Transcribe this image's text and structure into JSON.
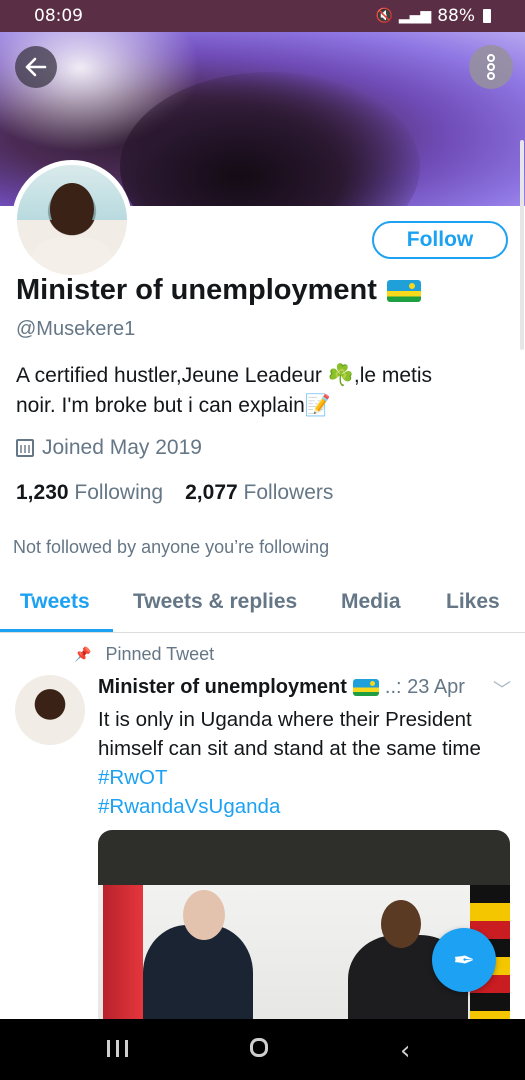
{
  "status_bar": {
    "time": "08:09",
    "battery": "88%"
  },
  "profile": {
    "follow_label": "Follow",
    "name": "Minister of unemployment",
    "handle": "@Musekere1",
    "bio_line1": "A certified hustler,Jeune Leadeur ☘️,le metis",
    "bio_line2": "noir. I'm broke but i can explain📝",
    "joined": "Joined May 2019",
    "following_count": "1,230",
    "following_label": "Following",
    "followers_count": "2,077",
    "followers_label": "Followers",
    "not_followed": "Not followed by anyone you’re following"
  },
  "tabs": [
    {
      "label": "Tweets",
      "active": true
    },
    {
      "label": "Tweets & replies",
      "active": false
    },
    {
      "label": "Media",
      "active": false
    },
    {
      "label": "Likes",
      "active": false
    }
  ],
  "tweet": {
    "pinned_label": "Pinned Tweet",
    "author": "Minister of unemployment",
    "date": "..: 23 Apr",
    "text_line1": "It is only in Uganda where their President",
    "text_line2": "himself can sit and stand at the same time",
    "hashtag1": "#RwOT",
    "hashtag2": "#RwandaVsUganda"
  },
  "colors": {
    "accent": "#1da1f2",
    "status_bar": "#5a2f45",
    "muted": "#657786"
  },
  "icons": [
    "back-arrow-icon",
    "more-vertical-icon",
    "calendar-icon",
    "pin-icon",
    "chevron-down-icon",
    "compose-icon",
    "rwanda-flag-icon"
  ]
}
